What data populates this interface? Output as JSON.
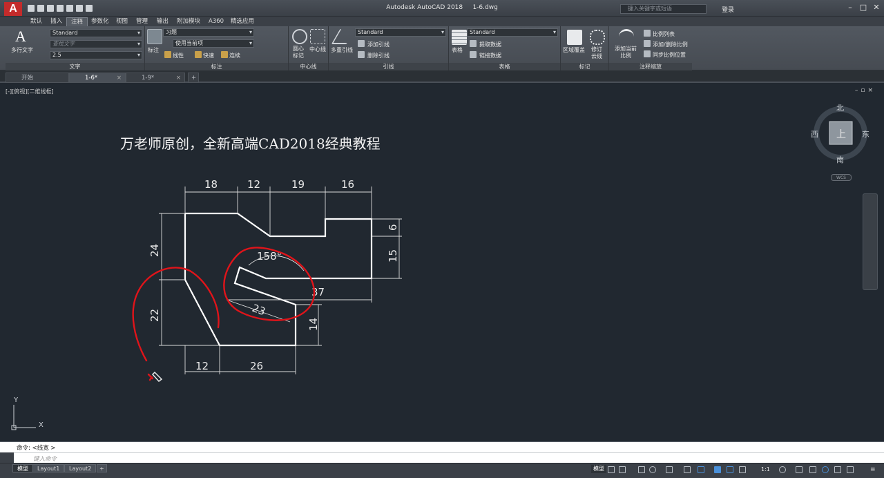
{
  "app": {
    "title": "Autodesk AutoCAD 2018",
    "file": "1-6.dwg",
    "logo": "A"
  },
  "search": {
    "placeholder": "键入关键字或短语"
  },
  "user": {
    "login": "登录"
  },
  "ribbon_tabs": [
    "默认",
    "插入",
    "注释",
    "参数化",
    "视图",
    "管理",
    "输出",
    "附加模块",
    "A360",
    "精选应用"
  ],
  "active_tab": "注释",
  "panels": {
    "text": {
      "title": "文字",
      "big_label": "多行文字",
      "style": "Standard",
      "find_placeholder": "查找文字",
      "height": "2.5"
    },
    "dim": {
      "title": "标注",
      "big_label": "标注",
      "dimstyle": "习题",
      "layer": "使用当前项",
      "linear": "线性",
      "quick": "快速",
      "continue": "连续"
    },
    "centerline": {
      "title": "中心线",
      "center_mark": "圆心标记",
      "center_line": "中心线"
    },
    "leader": {
      "title": "引线",
      "big_label": "多重引线",
      "style": "Standard",
      "add": "添加引线",
      "remove": "删除引线"
    },
    "table": {
      "title": "表格",
      "big_label": "表格",
      "style": "Standard",
      "extract": "提取数据",
      "link": "链接数据"
    },
    "markup": {
      "title": "标记",
      "wipeout": "区域覆盖",
      "revcloud": "修订云线"
    },
    "scale": {
      "title": "注释缩放",
      "add_scale": "添加当前比例",
      "list": "比例列表",
      "add_del": "添加/删除比例",
      "sync": "同步比例位置"
    }
  },
  "doc_tabs": [
    {
      "label": "开始"
    },
    {
      "label": "1-6*"
    },
    {
      "label": "1-9*"
    }
  ],
  "viewport": {
    "label": "[-][俯视][二维线框]",
    "heading": "万老师原创，全新高端CAD2018经典教程",
    "viewcube": {
      "north": "北",
      "south": "南",
      "east": "东",
      "west": "西",
      "face": "上",
      "wcs": "WCS"
    },
    "ucs": {
      "x": "X",
      "y": "Y"
    }
  },
  "dims": {
    "top": [
      "18",
      "12",
      "19",
      "16"
    ],
    "right": [
      "6",
      "15"
    ],
    "left": [
      "24",
      "22"
    ],
    "bottom": [
      "12",
      "26"
    ],
    "angle": "158°",
    "inner": [
      "37",
      "23",
      "14"
    ]
  },
  "command": {
    "history": "命令:  <线宽 >",
    "prompt_label": "命令:",
    "placeholder": "键入命令"
  },
  "status_tabs": [
    "模型",
    "Layout1",
    "Layout2"
  ],
  "status": {
    "model": "模型",
    "scale": "1:1"
  },
  "colors": {
    "bg": "#212830",
    "drawing": "#ffffff",
    "markup": "#e0141a",
    "ribbon": "#4b5057"
  }
}
